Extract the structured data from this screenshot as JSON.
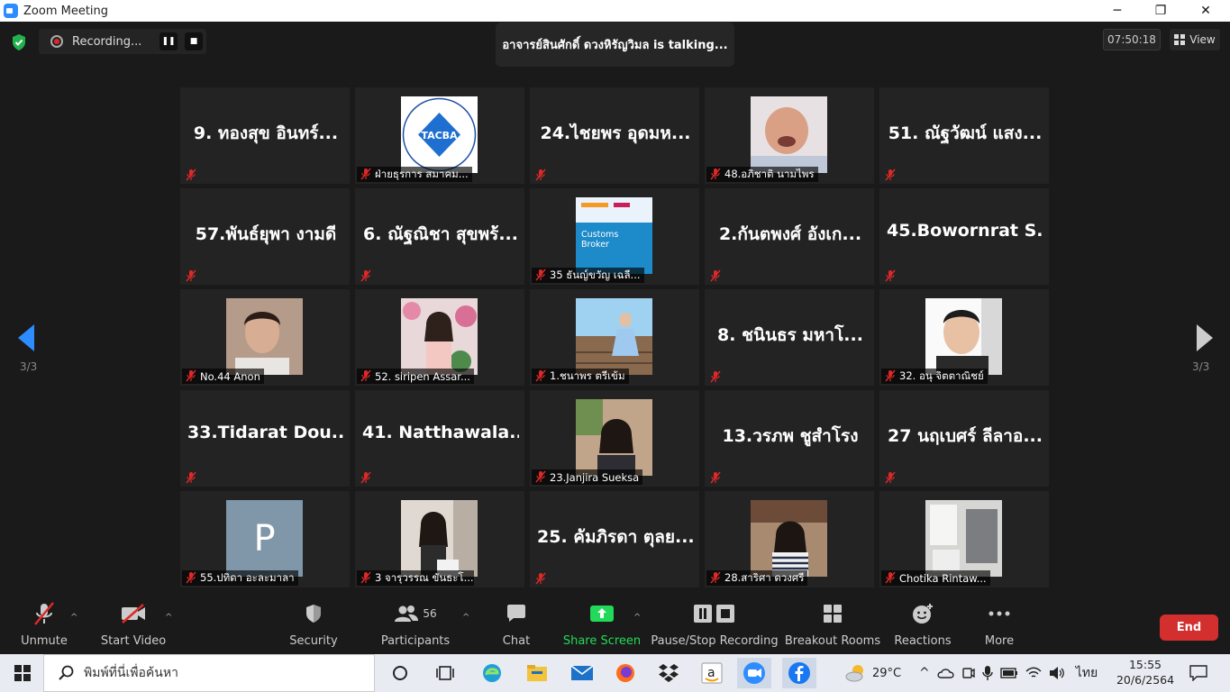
{
  "window": {
    "title": "Zoom Meeting",
    "minimize": "─",
    "restore": "❐",
    "close": "✕"
  },
  "recording": {
    "label": "Recording..."
  },
  "talking": "อาจารย์สินศักดิ์  ดวงหิรัญวิมล is  talking...",
  "clock": "07:50:18",
  "view_label": "View",
  "page_indicator": "3/3",
  "tiles": [
    {
      "name": "9. ทองสุข อินทร์...",
      "label": ""
    },
    {
      "name": "",
      "label": "ฝ่ายธุรการ สมาคม...",
      "image": "tacba-logo",
      "logo_text": "TACBA"
    },
    {
      "name": "24.ไชยพร อุดมห...",
      "label": ""
    },
    {
      "name": "",
      "label": "48.อภิชาติ นามไพร",
      "image": "baby-photo"
    },
    {
      "name": "51. ณัฐวัฒน์ แสง...",
      "label": ""
    },
    {
      "name": "57.พันธ์ยุพา งามดี",
      "label": ""
    },
    {
      "name": "6. ณัฐณิชา สุขพร้...",
      "label": ""
    },
    {
      "name": "",
      "label": "35 ธันญ์ขวัญ เฉลี...",
      "image": "customs-broker-poster",
      "poster_text": "Customs Broker"
    },
    {
      "name": "2.กันตพงศ์ อังเก...",
      "label": ""
    },
    {
      "name": "45.Bowornrat  S...",
      "label": ""
    },
    {
      "name": "",
      "label": "No.44 Anon",
      "image": "man-photo"
    },
    {
      "name": "",
      "label": "52. siripen Assar...",
      "image": "woman-flowers-photo"
    },
    {
      "name": "",
      "label": "1.ชนาพร  ตรีเข้ม",
      "image": "woman-bridge-photo"
    },
    {
      "name": "8. ชนินธร มหาโ...",
      "label": ""
    },
    {
      "name": "",
      "label": "32. อนุ จิตตาณิชย์",
      "image": "man-selfie-photo"
    },
    {
      "name": "33.Tidarat  Dou...",
      "label": ""
    },
    {
      "name": "41.  Natthawala...",
      "label": ""
    },
    {
      "name": "",
      "label": "23.Janjira Sueksa",
      "image": "woman-outdoor-photo"
    },
    {
      "name": "13.วรภพ ชูสำโรง",
      "label": ""
    },
    {
      "name": "27 นฤเบศร์ ลีลาอ...",
      "label": ""
    },
    {
      "name": "",
      "label": "55.ปทิดา อะละมาลา",
      "image": "avatar-letter",
      "letter": "P"
    },
    {
      "name": "",
      "label": "3 จารุวรรณ ขันธะโ...",
      "image": "woman-mirror-photo"
    },
    {
      "name": "25. คัมภิรดา ตุลย...",
      "label": ""
    },
    {
      "name": "",
      "label": "28.สาริศา ดวงศรี",
      "image": "woman-cafe-photo"
    },
    {
      "name": "",
      "label": "Chotika Rintaw...",
      "image": "room-photo"
    }
  ],
  "toolbar": {
    "unmute": "Unmute",
    "start_video": "Start Video",
    "security": "Security",
    "participants": "Participants",
    "participants_count": "56",
    "chat": "Chat",
    "share_screen": "Share Screen",
    "pause_recording": "Pause/Stop Recording",
    "breakout_rooms": "Breakout Rooms",
    "reactions": "Reactions",
    "more": "More",
    "end": "End"
  },
  "taskbar": {
    "search_placeholder": "พิมพ์ที่นี่เพื่อค้นหา",
    "temperature": "29°C",
    "language": "ไทย",
    "time": "15:55",
    "date": "20/6/2564"
  },
  "colors": {
    "share_green": "#23d959",
    "end_red": "#d32f2f",
    "arrow_blue": "#2d8cff",
    "mute_red": "#e02828"
  }
}
